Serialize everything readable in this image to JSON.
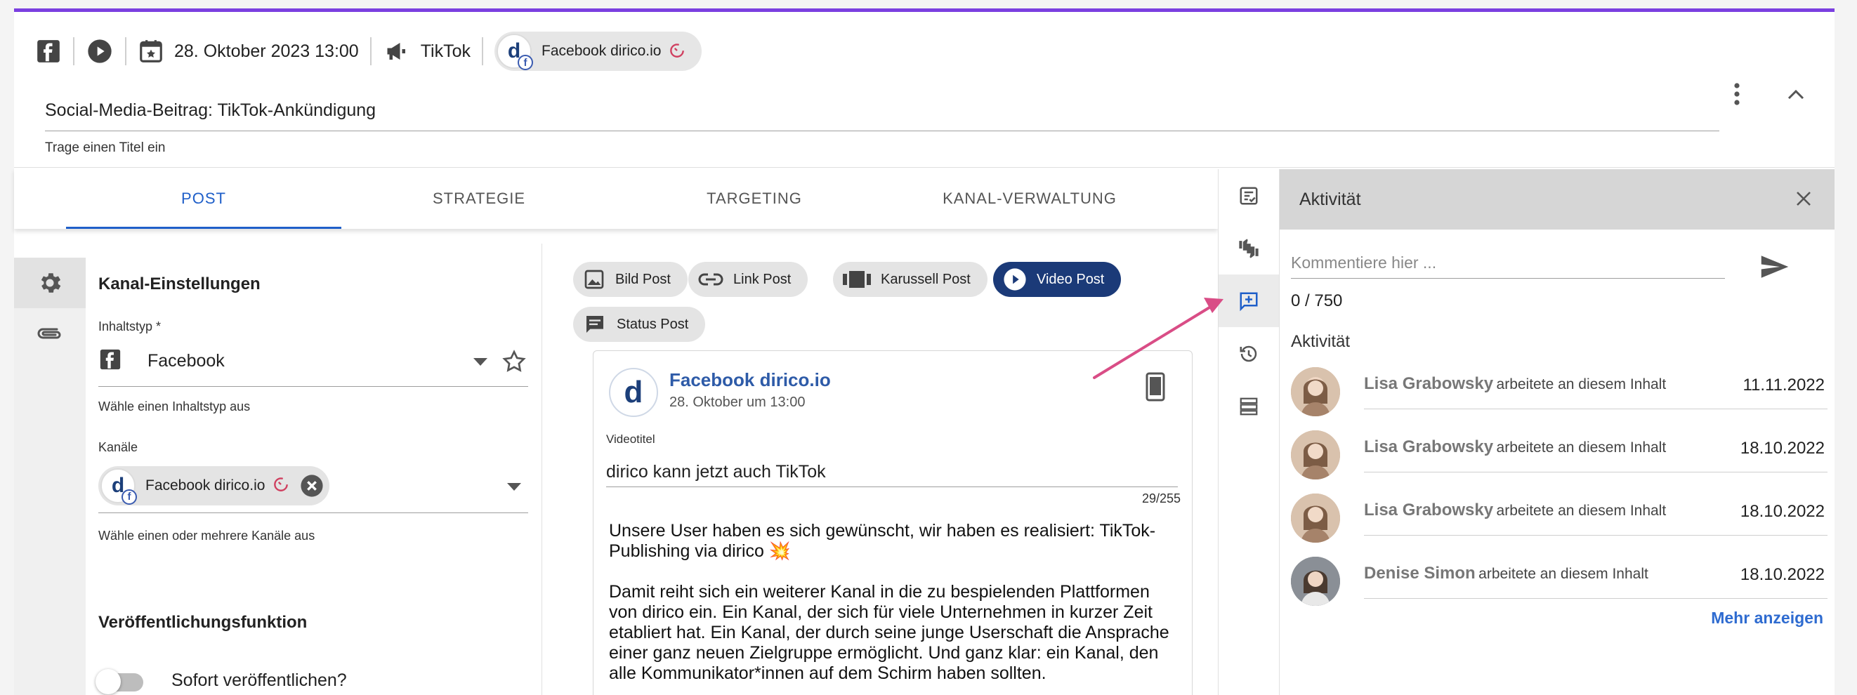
{
  "header": {
    "date": "28. Oktober 2023 13:00",
    "channel_type": "TikTok",
    "account_chip": "Facebook dirico.io",
    "title_value": "Social-Media-Beitrag: TikTok-Ankündigung",
    "title_hint": "Trage einen Titel ein"
  },
  "tabs": [
    "POST",
    "STRATEGIE",
    "TARGETING",
    "KANAL-VERWALTUNG"
  ],
  "settings": {
    "section_title": "Kanal-Einstellungen",
    "content_type_label": "Inhaltstyp *",
    "content_type_value": "Facebook",
    "content_type_hint": "Wähle einen Inhaltstyp aus",
    "channels_label": "Kanäle",
    "channel_chip": "Facebook dirico.io",
    "channels_hint": "Wähle einen oder mehrere Kanäle aus",
    "publish_title": "Veröffentlichungsfunktion",
    "publish_toggle_label": "Sofort veröffentlichen?"
  },
  "post_types": [
    {
      "label": "Bild Post",
      "icon": "image-icon"
    },
    {
      "label": "Link Post",
      "icon": "link-icon"
    },
    {
      "label": "Karussell Post",
      "icon": "carousel-icon"
    },
    {
      "label": "Video Post",
      "icon": "play-icon"
    },
    {
      "label": "Status Post",
      "icon": "message-icon"
    }
  ],
  "preview": {
    "page_name": "Facebook dirico.io",
    "date": "28. Oktober um 13:00",
    "video_title_label": "Videotitel",
    "video_title": "dirico kann jetzt auch TikTok",
    "char_count": "29/255",
    "body": "Unsere User haben es sich gewünscht, wir haben es realisiert: TikTok-Publishing via dirico 💥\n\nDamit reiht sich ein weiterer Kanal in die zu bespielenden Plattformen von dirico ein. Ein Kanal, der sich für viele Unternehmen in kurzer Zeit etabliert hat. Ein Kanal, der durch seine junge Userschaft die Ansprache einer ganz neuen Zielgruppe ermöglicht. Und ganz klar: ein Kanal, den alle Kommunikator*innen auf dem Schirm haben sollten."
  },
  "activity": {
    "title": "Aktivität",
    "comment_placeholder": "Kommentiere hier ...",
    "comment_count": "0 / 750",
    "subtitle": "Aktivität",
    "items": [
      {
        "name": "Lisa Grabowsky",
        "action": "arbeitete an diesem Inhalt",
        "date": "11.11.2022"
      },
      {
        "name": "Lisa Grabowsky",
        "action": "arbeitete an diesem Inhalt",
        "date": "18.10.2022"
      },
      {
        "name": "Lisa Grabowsky",
        "action": "arbeitete an diesem Inhalt",
        "date": "18.10.2022"
      },
      {
        "name": "Denise Simon",
        "action": "arbeitete an diesem Inhalt",
        "date": "18.10.2022"
      }
    ],
    "more_label": "Mehr anzeigen"
  },
  "colors": {
    "accent_top": "#7b3fe0",
    "tab_active": "#1f5fc9",
    "video_post_active": "#1b3a78",
    "annotation_arrow": "#d94d86"
  }
}
